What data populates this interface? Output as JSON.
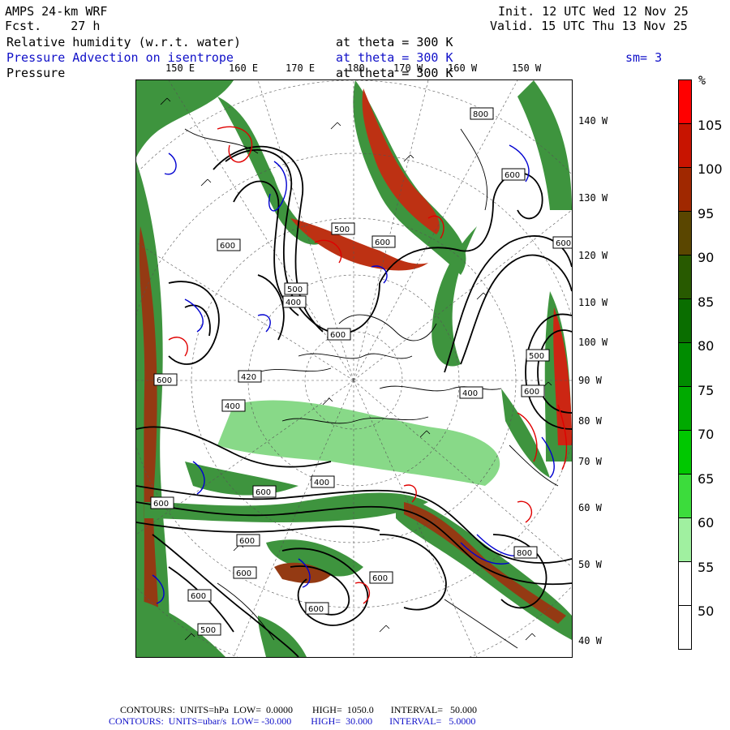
{
  "header": {
    "model": "AMPS 24-km WRF",
    "fcst": "Fcst.    27 h",
    "init": "Init. 12 UTC Wed 12 Nov 25",
    "valid": "Valid. 15 UTC Thu 13 Nov 25"
  },
  "fields": {
    "rh_label": "Relative humidity (w.r.t. water)",
    "rh_theta": "at theta = 300 K",
    "adv_label": "Pressure Advection on isentrope",
    "adv_theta": "at theta = 300 K",
    "smooth": "sm= 3",
    "pres_label": "Pressure",
    "pres_theta": "at theta = 300 K"
  },
  "lon_labels_top": [
    "150 E",
    "160 E",
    "170 E",
    "180",
    "170 W",
    "160 W",
    "150 W"
  ],
  "lat_labels_right": [
    "140 W",
    "130 W",
    "120 W",
    "110 W",
    "100 W",
    "90 W",
    "80 W",
    "70 W",
    "60 W",
    "50 W",
    "40 W"
  ],
  "contour_labels": [
    "800",
    "600",
    "500",
    "400",
    "600",
    "420",
    "600",
    "400",
    "600",
    "600",
    "500",
    "400",
    "600",
    "400",
    "600",
    "600",
    "600",
    "600",
    "500",
    "600",
    "600",
    "800",
    "600",
    "500",
    "600"
  ],
  "colorbar": {
    "unit": "%",
    "labels": [
      "105",
      "100",
      "95",
      "90",
      "85",
      "80",
      "75",
      "70",
      "65",
      "60",
      "55",
      "50"
    ],
    "colors": [
      "#ff0000",
      "#c81400",
      "#a02800",
      "#5a4600",
      "#285a00",
      "#0a6e00",
      "#008c00",
      "#00aa00",
      "#00c800",
      "#3cdc3c",
      "#a0f0a0",
      "#ffffff",
      "#ffffff"
    ]
  },
  "footer": {
    "line1": "CONTOURS:  UNITS=hPa  LOW=  0.0000        HIGH=  1050.0       INTERVAL=   50.000",
    "line2": "CONTOURS:  UNITS=ubar/s  LOW= -30.000        HIGH=  30.000       INTERVAL=   5.0000"
  },
  "colors": {
    "red_contour": "#e00000",
    "blue_contour": "#0000d0",
    "pressure_contour": "#000000"
  }
}
